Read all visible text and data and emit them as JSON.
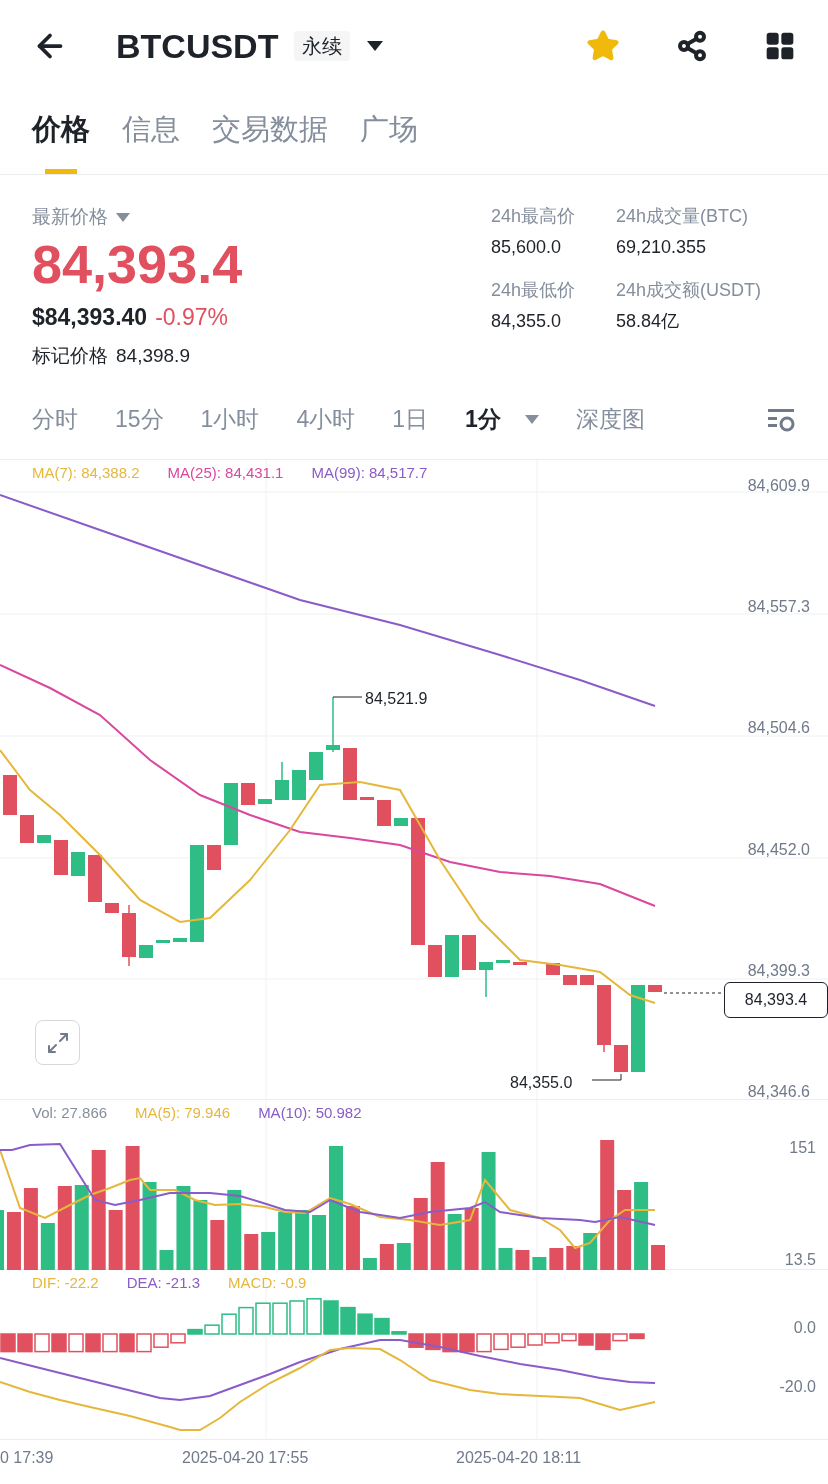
{
  "header": {
    "title": "BTCUSDT",
    "badge": "永续"
  },
  "tabs": [
    {
      "label": "价格",
      "selected": true
    },
    {
      "label": "信息",
      "selected": false
    },
    {
      "label": "交易数据",
      "selected": false
    },
    {
      "label": "广场",
      "selected": false
    }
  ],
  "ticker": {
    "label": "最新价格",
    "price": "84,393.4",
    "usd_price": "$84,393.40",
    "change": "-0.97%",
    "mark_label": "标记价格",
    "mark_price": "84,398.9"
  },
  "stats": [
    {
      "label": "24h最高价",
      "value": "85,600.0"
    },
    {
      "label": "24h成交量(BTC)",
      "value": "69,210.355"
    },
    {
      "label": "24h最低价",
      "value": "84,355.0"
    },
    {
      "label": "24h成交额(USDT)",
      "value": "58.84亿"
    }
  ],
  "intervals": [
    {
      "label": "分时",
      "kind": "plain",
      "selected": false
    },
    {
      "label": "15分",
      "kind": "plain",
      "selected": false
    },
    {
      "label": "1小时",
      "kind": "plain",
      "selected": false
    },
    {
      "label": "4小时",
      "kind": "plain",
      "selected": false
    },
    {
      "label": "1日",
      "kind": "plain",
      "selected": false
    },
    {
      "label": "1分",
      "kind": "dropdown",
      "selected": true
    },
    {
      "label": "深度图",
      "kind": "plain",
      "selected": false
    }
  ],
  "price_chart": {
    "legend": [
      {
        "label": "MA(7): 84,388.2",
        "color": "#e5b73b"
      },
      {
        "label": "MA(25): 84,431.1",
        "color": "#d9479f"
      },
      {
        "label": "MA(99): 84,517.7",
        "color": "#8a5cc9"
      }
    ],
    "ticks": [
      "84,609.9",
      "84,557.3",
      "84,504.6",
      "84,452.0",
      "84,399.3",
      "84,346.6"
    ],
    "high_label": "84,521.9",
    "low_label": "84,355.0",
    "last_price": "84,393.4"
  },
  "volume": {
    "legend": [
      {
        "label": "Vol: 27.866",
        "color": "#848e9c"
      },
      {
        "label": "MA(5): 79.946",
        "color": "#e5b73b"
      },
      {
        "label": "MA(10): 50.982",
        "color": "#8a5cc9"
      }
    ],
    "ticks": [
      "151",
      "13.5"
    ]
  },
  "macd": {
    "legend": [
      {
        "label": "DIF: -22.2",
        "color": "#e5b73b"
      },
      {
        "label": "DEA: -21.3",
        "color": "#8a5cc9"
      },
      {
        "label": "MACD: -0.9",
        "color": "#e5b73b"
      }
    ],
    "ticks": [
      "0.0",
      "-20.0"
    ]
  },
  "time_labels": [
    "0 17:39",
    "2025-04-20 17:55",
    "2025-04-20 18:11"
  ]
}
